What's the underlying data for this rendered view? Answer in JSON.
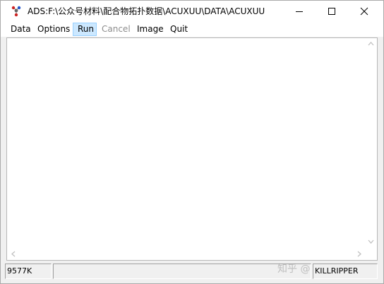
{
  "window": {
    "title": "ADS:F:\\公众号材料\\配合物拓扑数据\\ACUXUU\\DATA\\ACUXUU",
    "icon": "ads-app-icon",
    "controls": {
      "minimize_icon": "minimize-icon",
      "maximize_icon": "maximize-icon",
      "close_icon": "close-icon"
    }
  },
  "menu": {
    "items": [
      {
        "label": "Data",
        "state": "normal"
      },
      {
        "label": "Options",
        "state": "normal"
      },
      {
        "label": "Run",
        "state": "hover"
      },
      {
        "label": "Cancel",
        "state": "disabled"
      },
      {
        "label": "Image",
        "state": "normal"
      },
      {
        "label": "Quit",
        "state": "normal"
      }
    ]
  },
  "statusbar": {
    "memory": "9577K",
    "message": "",
    "right_pane": "KILLRIPPER"
  },
  "watermark": {
    "text": "知乎 @"
  },
  "colors": {
    "hover_bg": "#cce8ff",
    "disabled_text": "#8d8d8d",
    "window_bg": "#f0f0f0"
  }
}
